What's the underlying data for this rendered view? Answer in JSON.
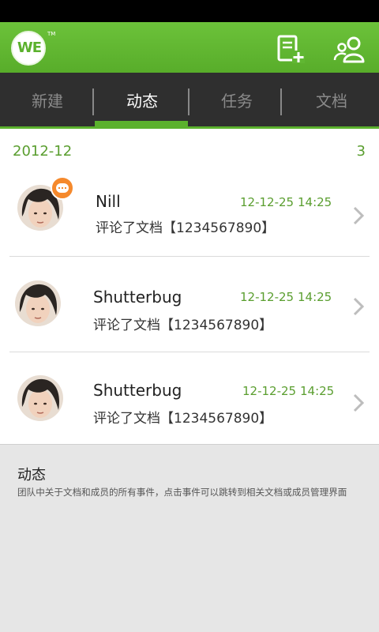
{
  "app": {
    "logo_text": "WE",
    "logo_tm": "TM"
  },
  "icons": {
    "new_doc": "new-document-icon",
    "contacts": "contacts-icon"
  },
  "colors": {
    "brand_green": "#5bb12d",
    "accent_text_green": "#5a9e2f",
    "tab_bar_bg": "#2f2f2f",
    "badge_orange": "#f5892c"
  },
  "tabs": [
    {
      "label": "新建",
      "active": false
    },
    {
      "label": "动态",
      "active": true
    },
    {
      "label": "任务",
      "active": false
    },
    {
      "label": "文档",
      "active": false
    }
  ],
  "feed": {
    "month": "2012-12",
    "count": "3",
    "items": [
      {
        "name": "Nill",
        "date": "12-12-25",
        "time": "14:25",
        "description": "评论了文档【1234567890】",
        "has_badge": true
      },
      {
        "name": "Shutterbug",
        "date": "12-12-25",
        "time": "14:25",
        "description": "评论了文档【1234567890】",
        "has_badge": false
      },
      {
        "name": "Shutterbug",
        "date": "12-12-25",
        "time": "14:25",
        "description": "评论了文档【1234567890】",
        "has_badge": false
      }
    ]
  },
  "info": {
    "title": "动态",
    "text": "团队中关于文档和成员的所有事件，点击事件可以跳转到相关文档或成员管理界面"
  }
}
